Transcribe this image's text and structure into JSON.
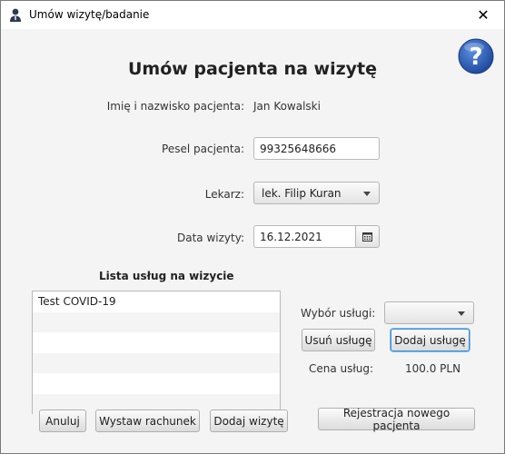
{
  "window": {
    "title": "Umów wizytę/badanie",
    "close_glyph": "✕"
  },
  "form": {
    "heading": "Umów pacjenta na wizytę",
    "patient_name_label": "Imię i nazwisko pacjenta:",
    "patient_name_value": "Jan Kowalski",
    "pesel_label": "Pesel pacjenta:",
    "pesel_value": "99325648666",
    "doctor_label": "Lekarz:",
    "doctor_value": "lek. Filip Kuran",
    "date_label": "Data wizyty:",
    "date_value": "16.12.2021"
  },
  "services": {
    "list_title": "Lista usług na wizycie",
    "items": [
      "Test COVID-19",
      "",
      "",
      "",
      "",
      ""
    ],
    "choice_label": "Wybór usługi:",
    "choice_value": "",
    "remove_label": "Usuń usługę",
    "add_label": "Dodaj usługę",
    "price_label": "Cena usług:",
    "price_value": "100.0 PLN"
  },
  "footer": {
    "cancel_label": "Anuluj",
    "invoice_label": "Wystaw rachunek",
    "add_visit_label": "Dodaj wizytę",
    "register_label": "Rejestracja nowego pacjenta"
  },
  "icons": {
    "app": "user-icon",
    "help": "help-icon",
    "calendar": "calendar-icon",
    "dropdown": "chevron-down-icon"
  },
  "colors": {
    "help_blue": "#2a58b0",
    "focus_blue": "#3c8fd4",
    "background": "#f4f4f4"
  }
}
